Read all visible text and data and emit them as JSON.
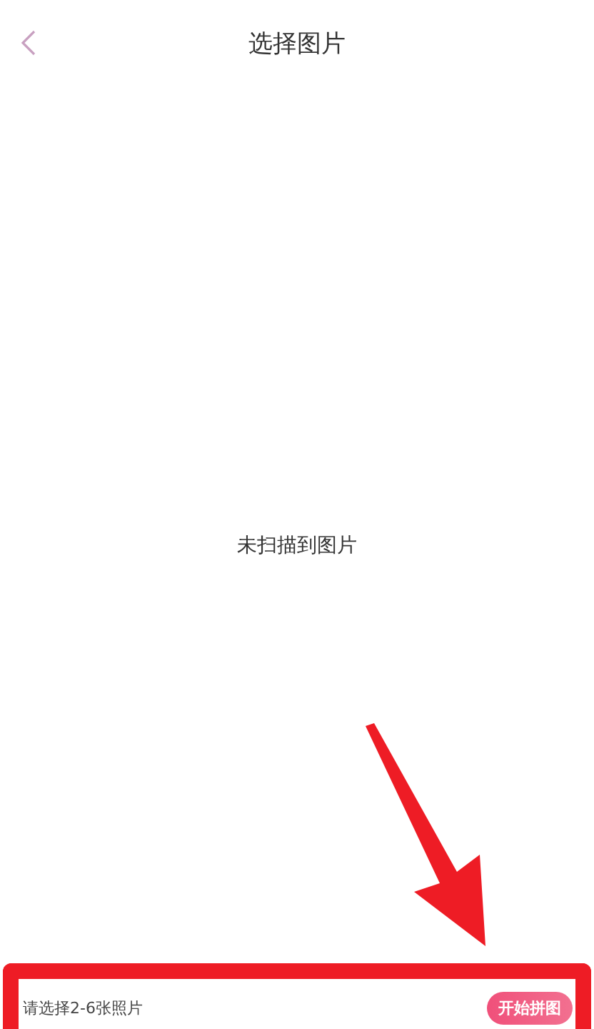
{
  "header": {
    "title": "选择图片"
  },
  "empty_message": "未扫描到图片",
  "bottom_bar": {
    "hint": "请选择2-6张照片",
    "button": "开始拼图"
  }
}
